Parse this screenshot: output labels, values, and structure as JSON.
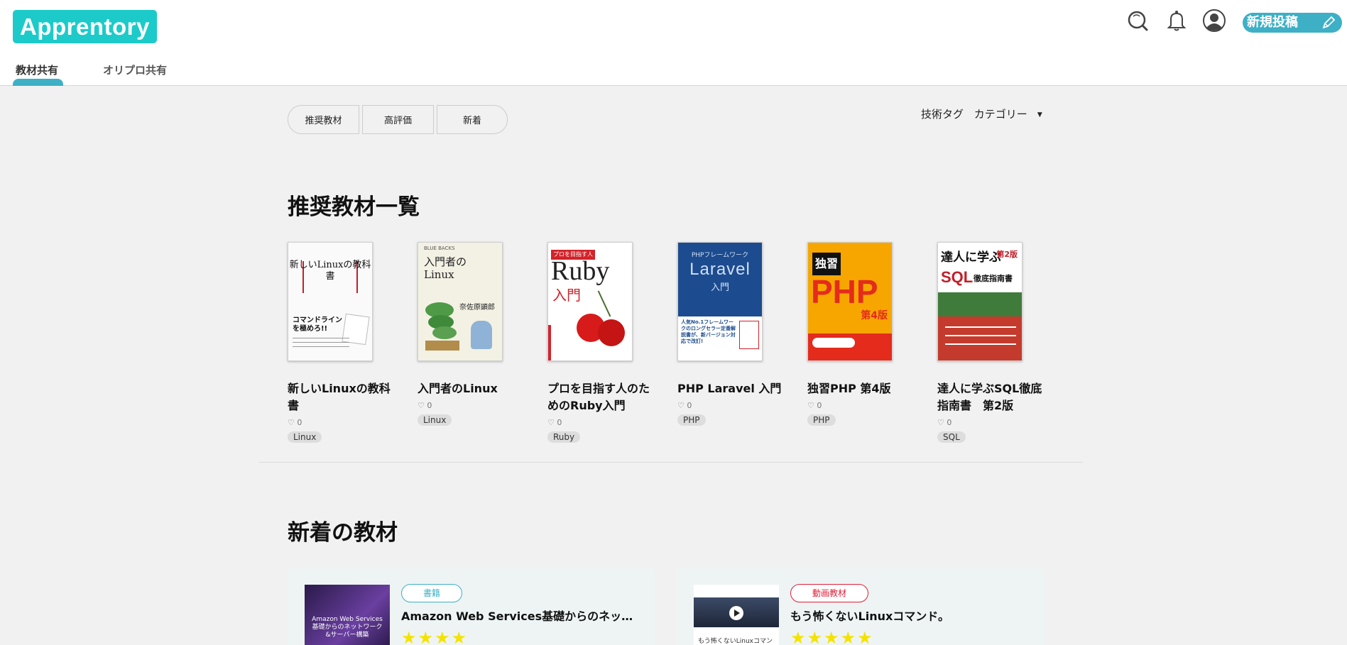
{
  "header": {
    "logo": "Apprentory",
    "tabs": [
      {
        "label": "教材共有",
        "active": true
      },
      {
        "label": "オリプロ共有",
        "active": false
      }
    ],
    "post_button": "新規投稿",
    "icons": [
      "search-icon",
      "bell-icon",
      "user-avatar-icon",
      "pencil-icon"
    ],
    "accent_color": "#1ccbc9"
  },
  "filters": {
    "buttons": [
      "推奨教材",
      "高評価",
      "新着"
    ],
    "tech_tag": "技術タグ",
    "category": "カテゴリー"
  },
  "recommended": {
    "heading": "推奨教材一覧",
    "books": [
      {
        "title": "新しいLinuxの教科書",
        "likes": "♡ 0",
        "tag": "Linux"
      },
      {
        "title": "入門者のLinux",
        "likes": "♡ 0",
        "tag": "Linux"
      },
      {
        "title": "プロを目指す人のためのRuby入門",
        "likes": "♡ 0",
        "tag": "Ruby"
      },
      {
        "title": "PHP Laravel 入門",
        "likes": "♡ 0",
        "tag": "PHP"
      },
      {
        "title": "独習PHP 第4版",
        "likes": "♡ 0",
        "tag": "PHP"
      },
      {
        "title": "達人に学ぶSQL徹底指南書　第2版",
        "likes": "♡ 0",
        "tag": "SQL"
      }
    ],
    "cover_texts": {
      "linux1_title": "新しいLinuxの教科書",
      "linux1_sub": "コマンドラインを極めろ!!",
      "linux2_series": "BLUE BACKS",
      "linux2_title": "入門者のLinux",
      "linux2_author": "奈佐原顕郎",
      "ruby_top": "プロを目指す人",
      "ruby_big": "Ruby",
      "ruby_sub": "入門",
      "laravel_top": "PHPフレームワーク",
      "laravel_big": "Laravel",
      "laravel_sub": "入門",
      "laravel_bottom": "人気No.1フレームワークのロングセラー定番解説書が、新バージョン対応で改訂!",
      "php_top": "独習",
      "php_big": "PHP",
      "php_ed": "第4版",
      "sql_top": "達人に学ぶ",
      "sql_big": "SQL",
      "sql_sub": "徹底指南書",
      "sql_ed": "第2版"
    }
  },
  "new_items": {
    "heading": "新着の教材",
    "cards": [
      {
        "badge": "書籍",
        "badge_color": "#3db0c6",
        "title": "Amazon Web Services基礎からのネットワーク&サーバー構築",
        "thumb_text": "Amazon Web Services 基礎からのネットワーク&サーバー構築",
        "stars": "★★★★"
      },
      {
        "badge": "動画教材",
        "badge_color": "#e0203a",
        "title": "もう怖くないLinuxコマンド。",
        "thumb_text": "もう怖くないLinuxコマンド。",
        "stars": "★★★★★"
      }
    ]
  }
}
